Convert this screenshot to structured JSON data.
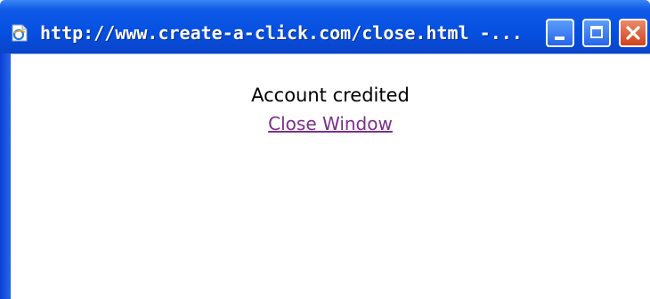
{
  "window": {
    "title": "http://www.create-a-click.com/close.html -...",
    "title_icon": "ie-page-icon",
    "buttons": {
      "minimize": "minimize-icon",
      "maximize": "maximize-icon",
      "close": "close-icon"
    }
  },
  "content": {
    "message": "Account credited",
    "close_link": "Close Window"
  },
  "colors": {
    "titlebar": "#0550e0",
    "link_visited": "#7a2f8a",
    "close_button": "#d0431c"
  }
}
